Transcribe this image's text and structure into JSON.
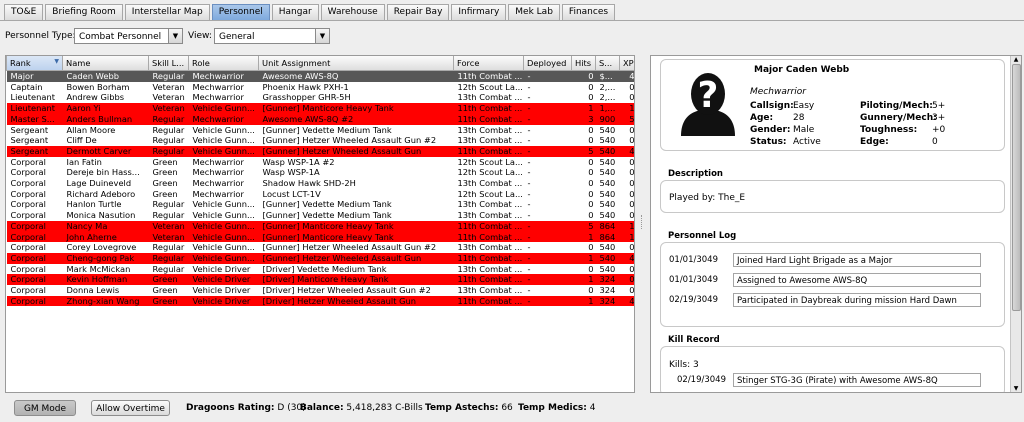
{
  "tabs": [
    "TO&E",
    "Briefing Room",
    "Interstellar Map",
    "Personnel",
    "Hangar",
    "Warehouse",
    "Repair Bay",
    "Infirmary",
    "Mek Lab",
    "Finances"
  ],
  "active_tab": "Personnel",
  "filters": {
    "type_label": "Personnel Type:",
    "type_value": "Combat Personnel",
    "view_label": "View:",
    "view_value": "General"
  },
  "table": {
    "columns": [
      "Rank",
      "Name",
      "Skill L...",
      "Role",
      "Unit Assignment",
      "Force",
      "Deployed",
      "Hits",
      "S...",
      "XP"
    ],
    "sort_column": "Rank",
    "rows": [
      {
        "style": "sel",
        "cells": [
          "Major",
          "Caden Webb",
          "Regular",
          "Mechwarrior",
          "Awesome AWS-8Q",
          "11th Combat ...",
          "-",
          "0",
          "$...",
          "4"
        ]
      },
      {
        "style": "norm",
        "cells": [
          "Captain",
          "Bowen Borham",
          "Veteran",
          "Mechwarrior",
          "Phoenix Hawk PXH-1",
          "12th Scout La...",
          "-",
          "0",
          "2,...",
          "0"
        ]
      },
      {
        "style": "norm",
        "cells": [
          "Lieutenant",
          "Andrew Gibbs",
          "Veteran",
          "Mechwarrior",
          "Grasshopper GHR-5H",
          "13th Combat ...",
          "-",
          "0",
          "2,...",
          "0"
        ]
      },
      {
        "style": "red",
        "cells": [
          "Lieutenant",
          "Aaron Yi",
          "Veteran",
          "Vehicle Gunn...",
          "[Gunner] Manticore Heavy Tank",
          "11th Combat ...",
          "-",
          "1",
          "1,...",
          "1"
        ]
      },
      {
        "style": "red",
        "cells": [
          "Master S...",
          "Anders Bullman",
          "Regular",
          "Mechwarrior",
          "Awesome AWS-8Q #2",
          "11th Combat ...",
          "-",
          "3",
          "900",
          "5"
        ]
      },
      {
        "style": "norm",
        "cells": [
          "Sergeant",
          "Allan Moore",
          "Regular",
          "Vehicle Gunn...",
          "[Gunner] Vedette Medium Tank",
          "13th Combat ...",
          "-",
          "0",
          "540",
          "0"
        ]
      },
      {
        "style": "norm",
        "cells": [
          "Sergeant",
          "Cliff De",
          "Regular",
          "Vehicle Gunn...",
          "[Gunner] Hetzer Wheeled Assault Gun #2",
          "13th Combat ...",
          "-",
          "0",
          "540",
          "0"
        ]
      },
      {
        "style": "red",
        "cells": [
          "Sergeant",
          "Dermott Carver",
          "Regular",
          "Vehicle Gunn...",
          "[Gunner] Hetzer Wheeled Assault Gun",
          "11th Combat ...",
          "-",
          "5",
          "540",
          "4"
        ]
      },
      {
        "style": "norm",
        "cells": [
          "Corporal",
          "Ian Fatin",
          "Green",
          "Mechwarrior",
          "Wasp WSP-1A #2",
          "12th Scout La...",
          "-",
          "0",
          "540",
          "0"
        ]
      },
      {
        "style": "norm",
        "cells": [
          "Corporal",
          "Dereje bin Hass...",
          "Green",
          "Mechwarrior",
          "Wasp WSP-1A",
          "12th Scout La...",
          "-",
          "0",
          "540",
          "0"
        ]
      },
      {
        "style": "norm",
        "cells": [
          "Corporal",
          "Lage Duineveld",
          "Green",
          "Mechwarrior",
          "Shadow Hawk SHD-2H",
          "13th Combat ...",
          "-",
          "0",
          "540",
          "0"
        ]
      },
      {
        "style": "norm",
        "cells": [
          "Corporal",
          "Richard Adeboro",
          "Green",
          "Mechwarrior",
          "Locust LCT-1V",
          "12th Scout La...",
          "-",
          "0",
          "540",
          "0"
        ]
      },
      {
        "style": "norm",
        "cells": [
          "Corporal",
          "Hanlon Turtle",
          "Regular",
          "Vehicle Gunn...",
          "[Gunner] Vedette Medium Tank",
          "13th Combat ...",
          "-",
          "0",
          "540",
          "0"
        ]
      },
      {
        "style": "norm",
        "cells": [
          "Corporal",
          "Monica Nasution",
          "Regular",
          "Vehicle Gunn...",
          "[Gunner] Vedette Medium Tank",
          "13th Combat ...",
          "-",
          "0",
          "540",
          "0"
        ]
      },
      {
        "style": "red",
        "cells": [
          "Corporal",
          "Nancy Ma",
          "Veteran",
          "Vehicle Gunn...",
          "[Gunner] Manticore Heavy Tank",
          "11th Combat ...",
          "-",
          "5",
          "864",
          "1"
        ]
      },
      {
        "style": "red",
        "cells": [
          "Corporal",
          "John Aherne",
          "Veteran",
          "Vehicle Gunn...",
          "[Gunner] Manticore Heavy Tank",
          "11th Combat ...",
          "-",
          "1",
          "864",
          "1"
        ]
      },
      {
        "style": "norm",
        "cells": [
          "Corporal",
          "Corey Lovegrove",
          "Regular",
          "Vehicle Gunn...",
          "[Gunner] Hetzer Wheeled Assault Gun #2",
          "13th Combat ...",
          "-",
          "0",
          "540",
          "0"
        ]
      },
      {
        "style": "red",
        "cells": [
          "Corporal",
          "Cheng-gong Pak",
          "Regular",
          "Vehicle Gunn...",
          "[Gunner] Hetzer Wheeled Assault Gun",
          "11th Combat ...",
          "-",
          "1",
          "540",
          "4"
        ]
      },
      {
        "style": "norm",
        "cells": [
          "Corporal",
          "Mark McMickan",
          "Regular",
          "Vehicle Driver",
          "[Driver] Vedette Medium Tank",
          "13th Combat ...",
          "-",
          "0",
          "540",
          "0"
        ]
      },
      {
        "style": "red",
        "cells": [
          "Corporal",
          "Kevin Hoffman",
          "Green",
          "Vehicle Driver",
          "[Driver] Manticore Heavy Tank",
          "11th Combat ...",
          "-",
          "1",
          "324",
          "0"
        ]
      },
      {
        "style": "norm",
        "cells": [
          "Corporal",
          "Donna Lewis",
          "Green",
          "Vehicle Driver",
          "[Driver] Hetzer Wheeled Assault Gun #2",
          "13th Combat ...",
          "-",
          "0",
          "324",
          "0"
        ]
      },
      {
        "style": "red",
        "cells": [
          "Corporal",
          "Zhong-xian Wang",
          "Green",
          "Vehicle Driver",
          "[Driver] Hetzer Wheeled Assault Gun",
          "11th Combat ...",
          "-",
          "1",
          "324",
          "4"
        ]
      }
    ]
  },
  "profile": {
    "name": "Major Caden Webb",
    "role": "Mechwarrior",
    "callsign_label": "Callsign:",
    "callsign": "Easy",
    "age_label": "Age:",
    "age": "28",
    "gender_label": "Gender:",
    "gender": "Male",
    "status_label": "Status:",
    "status": "Active",
    "piloting_label": "Piloting/Mech:",
    "piloting": "5+",
    "gunnery_label": "Gunnery/Mech:",
    "gunnery": "3+",
    "toughness_label": "Toughness:",
    "toughness": "+0",
    "edge_label": "Edge:",
    "edge": "0"
  },
  "description": {
    "header": "Description",
    "text": "Played by: The_E"
  },
  "log": {
    "header": "Personnel Log",
    "entries": [
      {
        "date": "01/01/3049",
        "text": "Joined Hard Light Brigade as a Major"
      },
      {
        "date": "01/01/3049",
        "text": "Assigned to Awesome AWS-8Q"
      },
      {
        "date": "02/19/3049",
        "text": "Participated in Daybreak during mission Hard Dawn"
      }
    ]
  },
  "kills": {
    "header": "Kill Record",
    "count_text": "Kills: 3",
    "entries": [
      {
        "date": "02/19/3049",
        "text": "Stinger STG-3G (Pirate) with Awesome AWS-8Q"
      }
    ]
  },
  "bottom": {
    "gm_mode": "GM Mode",
    "allow_overtime": "Allow Overtime",
    "rating_label": "Dragoons Rating:",
    "rating": "D (30)",
    "balance_label": "Balance:",
    "balance": "5,418,283 C-Bills",
    "astechs_label": "Temp Astechs:",
    "astechs": "66",
    "medics_label": "Temp Medics:",
    "medics": "4"
  },
  "colors": {
    "active_tab": "#8fb4e3",
    "selected_row": "#575757",
    "alert_row": "#ff0000"
  }
}
